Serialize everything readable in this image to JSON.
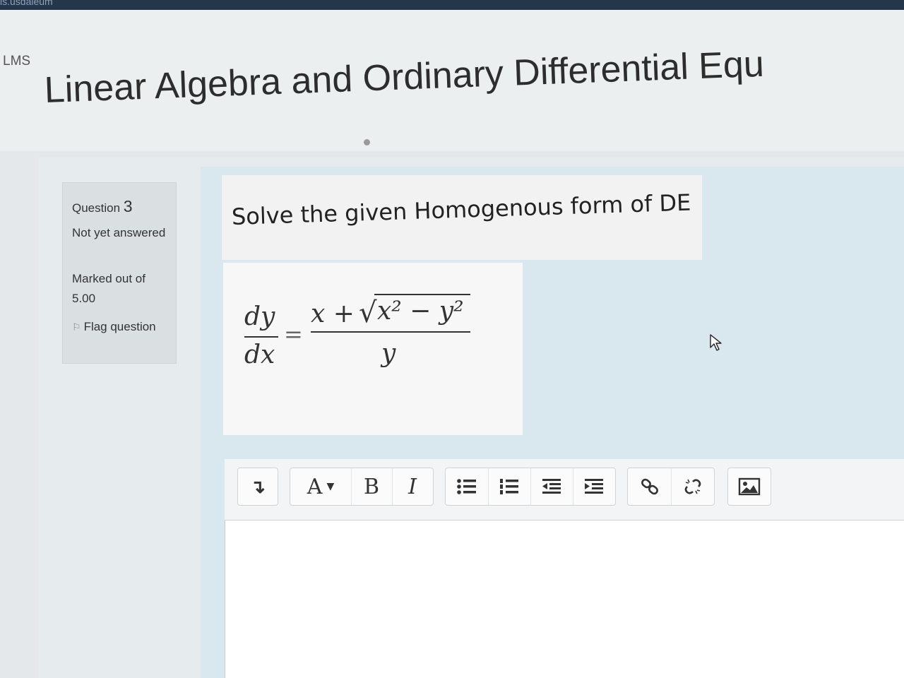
{
  "browser": {
    "tab_text": "is.usdaleum"
  },
  "header": {
    "site_label": "LMS",
    "course_title": "Linear Algebra and Ordinary Differential Equ"
  },
  "question_info": {
    "prefix": "Question ",
    "number": "3",
    "state": "Not yet answered",
    "marks": "Marked out of 5.00",
    "flag_label": "Flag question"
  },
  "question": {
    "prompt": "Solve the given Homogenous form of DE",
    "equation": {
      "lhs_numerator": "dy",
      "lhs_denominator": "dx",
      "equals": "=",
      "rhs_prefix": "x +",
      "sqrt_symbol": "√",
      "rhs_radicand": "x² − y²",
      "rhs_denominator": "y"
    }
  },
  "toolbar": {
    "groups": [
      [
        "expand"
      ],
      [
        "font-style",
        "bold",
        "italic"
      ],
      [
        "unordered-list",
        "ordered-list",
        "outdent",
        "indent"
      ],
      [
        "link",
        "unlink"
      ],
      [
        "image"
      ]
    ],
    "labels": {
      "expand": "↴",
      "font_style": "A",
      "bold": "B",
      "italic": "I"
    }
  },
  "editor": {
    "value": ""
  }
}
